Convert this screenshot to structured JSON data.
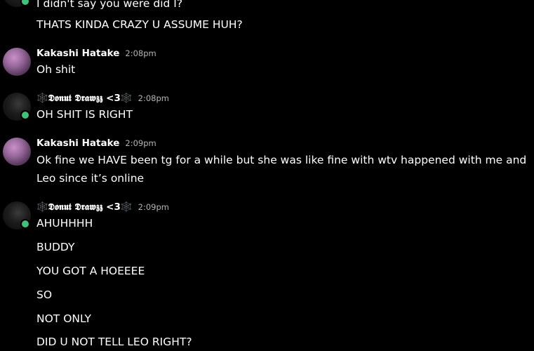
{
  "messages": {
    "m0": "I didn't say you were did I?",
    "m1": "THATS KINDA CRAZY U ASSUME HUH?",
    "g1": {
      "user": "Kakashi Hatake",
      "time": "2:08pm",
      "text": "Oh shit"
    },
    "g2": {
      "user": "🕸️𝕯𝖔𝖓𝖚𝖙 𝕯𝖗𝖆𝖜𝖟𝖟 <3🕸️",
      "time": "2:08pm",
      "text": "OH SHIT IS RIGHT"
    },
    "g3": {
      "user": "Kakashi Hatake",
      "time": "2:09pm",
      "text": "Ok fine we HAVE been tg for a while but she was like fine with wtv happened with me and Leo since it’s online"
    },
    "g4": {
      "user": "🕸️𝕯𝖔𝖓𝖚𝖙 𝕯𝖗𝖆𝖜𝖟𝖟 <3🕸️",
      "time": "2:09pm",
      "lines": [
        "AHUHHHH",
        "BUDDY",
        "YOU GOT A HOEEEE",
        "SO",
        "NOT ONLY",
        "DID U NOT TELL LEO RIGHT?"
      ]
    }
  },
  "colors": {
    "background": "#000000",
    "text": "#ffffff",
    "timestamp": "#b5b5b5",
    "online": "#3ec27a"
  }
}
